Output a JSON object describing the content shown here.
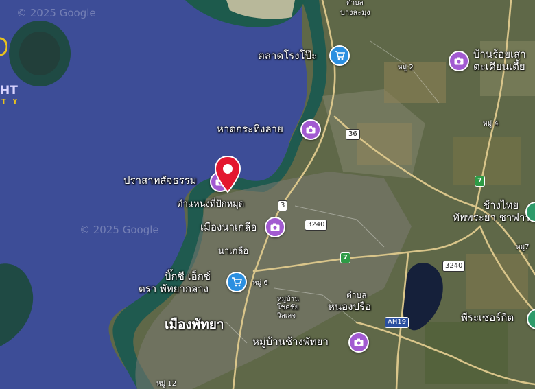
{
  "map": {
    "watermarks": [
      "© 2025 Google",
      "© 2025 Google"
    ],
    "brand": {
      "line1": "HT",
      "line2": "T Y",
      "color": "#e8c21e"
    },
    "labels": {
      "market": "ตลาดโรงโป๊ะ",
      "beach": "หาดกระทิงลาย",
      "castle": "ปราสาทสัจธรรม",
      "pin_label": "ตำแหน่งที่ปักหมุด",
      "naklua_city": "เมืองนาเกลือ",
      "naklua": "นาเกลือ",
      "bigc_l1": "บิ๊กซี เอ็กซ์",
      "bigc_l2": "ตรา พัทยากลาง",
      "pattaya": "เมืองพัทยา",
      "nongprue_l1": "ตำบล",
      "nongprue_l2": "หนองปรือ",
      "village": "หมู่บ้านช้างพัทยา",
      "village_small_l1": "หมู่บ้าน",
      "village_small_l2": "โชคชัย",
      "village_small_l3": "วิลเลจ",
      "tambon_top_l1": "ตำบล",
      "tambon_top_l2": "บางละมุง",
      "resort_l1": "บ้านร้อยเสา",
      "resort_l2": "ตะเคียนเตี้ย",
      "elephant_l1": "ช้างไทย",
      "elephant_l2": "ทัพพระยา ชาฟาร์",
      "wat": "พีระเซอร์กิต",
      "moo2": "หมู่ 2",
      "moo4": "หมู่ 4",
      "moo6": "หมู่ 6",
      "moo7": "หมู่7",
      "moo12": "หมู่ 12"
    },
    "shields": {
      "r36": "36",
      "r3240a": "3240",
      "r3240b": "3240",
      "ah19": "AH19",
      "g7a": "7",
      "g7b": "7",
      "r3": "3"
    },
    "colors": {
      "sea": "#3e4f9a",
      "poi_purple": "#a25ad1",
      "poi_blue": "#2b8fe0",
      "pin_red": "#e3172f"
    }
  }
}
